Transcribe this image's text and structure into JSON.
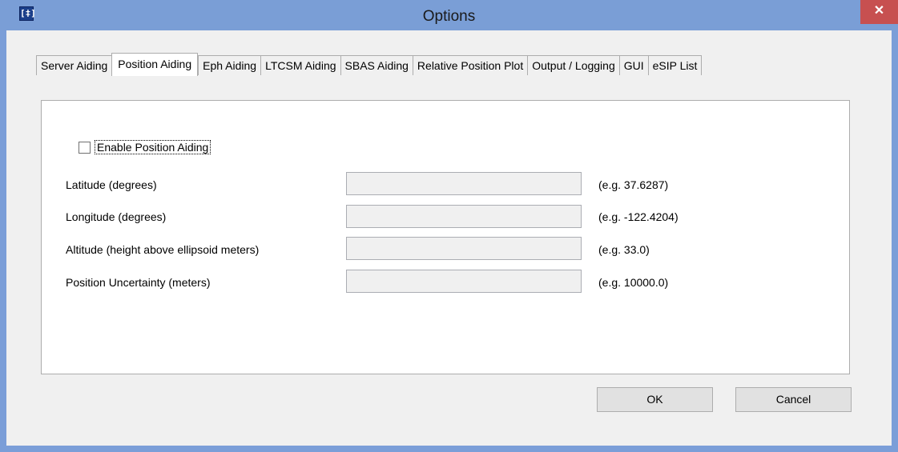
{
  "window": {
    "title": "Options",
    "close_glyph": "✕",
    "app_icon_glyph": "[‡]"
  },
  "tabs": [
    {
      "label": "Server Aiding",
      "active": false
    },
    {
      "label": "Position Aiding",
      "active": true
    },
    {
      "label": "Eph Aiding",
      "active": false
    },
    {
      "label": "LTCSM Aiding",
      "active": false
    },
    {
      "label": "SBAS Aiding",
      "active": false
    },
    {
      "label": "Relative Position Plot",
      "active": false
    },
    {
      "label": "Output / Logging",
      "active": false
    },
    {
      "label": "GUI",
      "active": false
    },
    {
      "label": "eSIP List",
      "active": false
    }
  ],
  "position_aiding": {
    "enable_label": "Enable Position Aiding",
    "enabled": false,
    "fields": [
      {
        "label": "Latitude (degrees)",
        "value": "",
        "hint": "(e.g. 37.6287)"
      },
      {
        "label": "Longitude (degrees)",
        "value": "",
        "hint": "(e.g. -122.4204)"
      },
      {
        "label": "Altitude (height above ellipsoid meters)",
        "value": "",
        "hint": "(e.g. 33.0)"
      },
      {
        "label": "Position Uncertainty (meters)",
        "value": "",
        "hint": "(e.g. 10000.0)"
      }
    ]
  },
  "buttons": {
    "ok": "OK",
    "cancel": "Cancel"
  },
  "colors": {
    "titlebar": "#7a9ed6",
    "close": "#c75050",
    "client": "#f0f0f0"
  }
}
